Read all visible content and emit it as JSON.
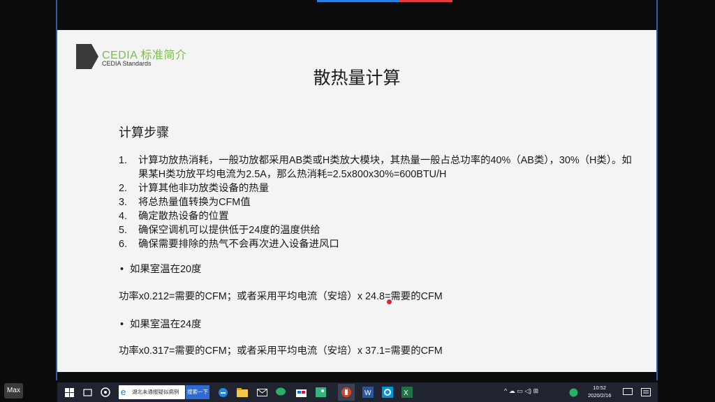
{
  "slide": {
    "logo": {
      "title": "CEDIA 标准简介",
      "subtitle": "CEDIA Standards"
    },
    "title": "散热量计算",
    "section_heading": "计算步骤",
    "steps": [
      {
        "num": "1.",
        "text": "计算功放热消耗，一般功放都采用AB类或H类放大模块，其热量一般占总功率的40%（AB类），30%（H类）。如果某H类功放平均电流为2.5A，那么热消耗=2.5x800x30%=600BTU/H"
      },
      {
        "num": "2.",
        "text": "计算其他非功放类设备的热量"
      },
      {
        "num": "3.",
        "text": "将总热量值转换为CFM值"
      },
      {
        "num": "4.",
        "text": "确定散热设备的位置"
      },
      {
        "num": "5.",
        "text": "确保空调机可以提供低于24度的温度供给"
      },
      {
        "num": "6.",
        "text": "确保需要排除的热气不会再次进入设备进风口"
      }
    ],
    "bullet_1": "如果室温在20度",
    "formula_1": "功率x0.212=需要的CFM；或者采用平均电流（安培）x 24.8=需要的CFM",
    "bullet_2": "如果室温在24度",
    "formula_2": "功率x0.317=需要的CFM；或者采用平均电流（安培）x 37.1=需要的CFM",
    "bullet_symbol": "•"
  },
  "overlay": {
    "max_label": "Max"
  },
  "taskbar": {
    "search_text": "湖北未通报疑似病例",
    "search_button": "搜索一下",
    "tray_text": "^ ☁ ▭ ◁) ⊞",
    "time": "10:52",
    "date": "2020/2/16"
  },
  "colors": {
    "logo_green": "#7dbd4a",
    "slide_bg": "#f4f4f4",
    "taskbar_bg": "#1f2430",
    "cursor_red": "#e2242b"
  }
}
